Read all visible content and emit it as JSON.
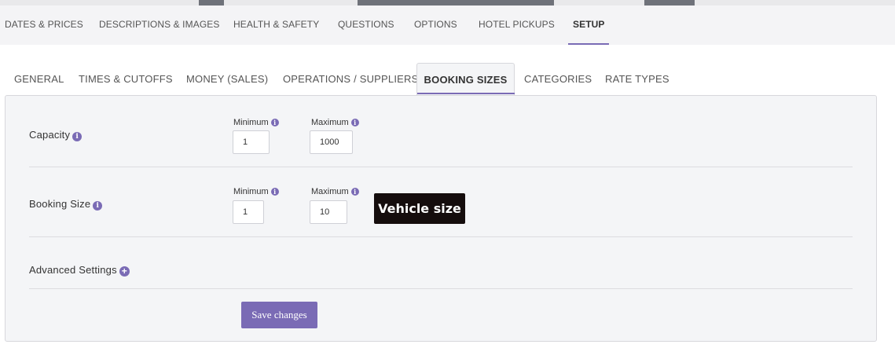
{
  "main_tabs": [
    {
      "label": "DATES & PRICES"
    },
    {
      "label": "DESCRIPTIONS & IMAGES"
    },
    {
      "label": "HEALTH & SAFETY"
    },
    {
      "label": "QUESTIONS"
    },
    {
      "label": "OPTIONS"
    },
    {
      "label": "HOTEL PICKUPS"
    },
    {
      "label": "SETUP",
      "active": true
    }
  ],
  "sub_tabs": [
    {
      "label": "GENERAL"
    },
    {
      "label": "TIMES & CUTOFFS"
    },
    {
      "label": "MONEY (SALES)"
    },
    {
      "label": "OPERATIONS / SUPPLIERS"
    },
    {
      "label": "BOOKING SIZES",
      "active": true
    },
    {
      "label": "CATEGORIES"
    },
    {
      "label": "RATE TYPES"
    }
  ],
  "capacity": {
    "label": "Capacity",
    "min_label": "Minimum",
    "max_label": "Maximum",
    "min_value": "1",
    "max_value": "1000"
  },
  "booking_size": {
    "label": "Booking Size",
    "min_label": "Minimum",
    "max_label": "Maximum",
    "min_value": "1",
    "max_value": "10"
  },
  "tooltip": {
    "text": "Vehicle size"
  },
  "advanced": {
    "label": "Advanced Settings"
  },
  "save_button": {
    "label": "Save changes"
  },
  "icons": {
    "info": "info-icon",
    "plus": "plus-circle-icon"
  },
  "colors": {
    "accent": "#7a6bb5",
    "tooltip_bg": "#150d0d",
    "panel_bg": "#f4f5f7"
  }
}
